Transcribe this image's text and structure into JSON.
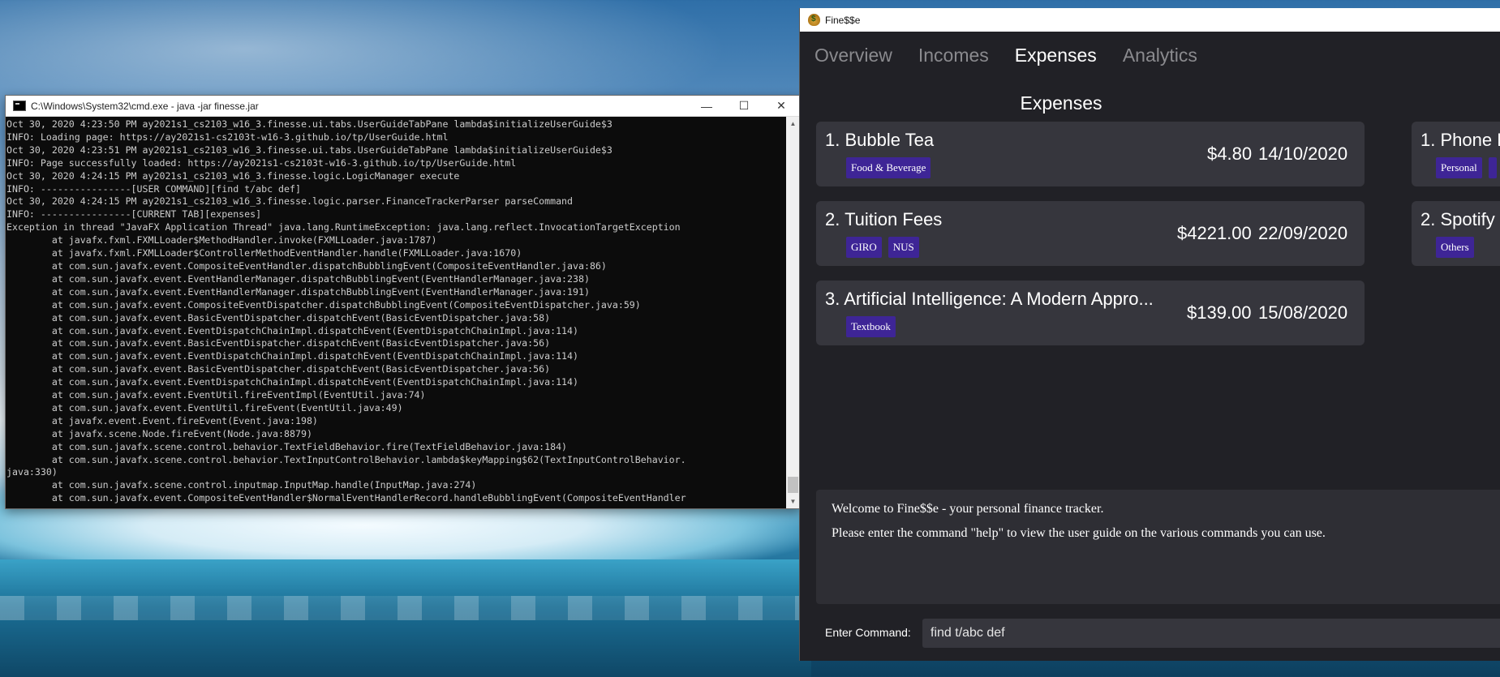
{
  "cmd_window": {
    "title": "C:\\Windows\\System32\\cmd.exe - java  -jar finesse.jar",
    "controls": {
      "minimize": "—",
      "maximize": "☐",
      "close": "✕"
    },
    "lines": [
      "Oct 30, 2020 4:23:50 PM ay2021s1_cs2103_w16_3.finesse.ui.tabs.UserGuideTabPane lambda$initializeUserGuide$3",
      "INFO: Loading page: https://ay2021s1-cs2103t-w16-3.github.io/tp/UserGuide.html",
      "Oct 30, 2020 4:23:51 PM ay2021s1_cs2103_w16_3.finesse.ui.tabs.UserGuideTabPane lambda$initializeUserGuide$3",
      "INFO: Page successfully loaded: https://ay2021s1-cs2103t-w16-3.github.io/tp/UserGuide.html",
      "Oct 30, 2020 4:24:15 PM ay2021s1_cs2103_w16_3.finesse.logic.LogicManager execute",
      "INFO: ----------------[USER COMMAND][find t/abc def]",
      "Oct 30, 2020 4:24:15 PM ay2021s1_cs2103_w16_3.finesse.logic.parser.FinanceTrackerParser parseCommand",
      "INFO: ----------------[CURRENT TAB][expenses]",
      "Exception in thread \"JavaFX Application Thread\" java.lang.RuntimeException: java.lang.reflect.InvocationTargetException",
      "        at javafx.fxml.FXMLLoader$MethodHandler.invoke(FXMLLoader.java:1787)",
      "        at javafx.fxml.FXMLLoader$ControllerMethodEventHandler.handle(FXMLLoader.java:1670)",
      "        at com.sun.javafx.event.CompositeEventHandler.dispatchBubblingEvent(CompositeEventHandler.java:86)",
      "        at com.sun.javafx.event.EventHandlerManager.dispatchBubblingEvent(EventHandlerManager.java:238)",
      "        at com.sun.javafx.event.EventHandlerManager.dispatchBubblingEvent(EventHandlerManager.java:191)",
      "        at com.sun.javafx.event.CompositeEventDispatcher.dispatchBubblingEvent(CompositeEventDispatcher.java:59)",
      "        at com.sun.javafx.event.BasicEventDispatcher.dispatchEvent(BasicEventDispatcher.java:58)",
      "        at com.sun.javafx.event.EventDispatchChainImpl.dispatchEvent(EventDispatchChainImpl.java:114)",
      "        at com.sun.javafx.event.BasicEventDispatcher.dispatchEvent(BasicEventDispatcher.java:56)",
      "        at com.sun.javafx.event.EventDispatchChainImpl.dispatchEvent(EventDispatchChainImpl.java:114)",
      "        at com.sun.javafx.event.BasicEventDispatcher.dispatchEvent(BasicEventDispatcher.java:56)",
      "        at com.sun.javafx.event.EventDispatchChainImpl.dispatchEvent(EventDispatchChainImpl.java:114)",
      "        at com.sun.javafx.event.EventUtil.fireEventImpl(EventUtil.java:74)",
      "        at com.sun.javafx.event.EventUtil.fireEvent(EventUtil.java:49)",
      "        at javafx.event.Event.fireEvent(Event.java:198)",
      "        at javafx.scene.Node.fireEvent(Node.java:8879)",
      "        at com.sun.javafx.scene.control.behavior.TextFieldBehavior.fire(TextFieldBehavior.java:184)",
      "        at com.sun.javafx.scene.control.behavior.TextInputControlBehavior.lambda$keyMapping$62(TextInputControlBehavior.",
      "java:330)",
      "        at com.sun.javafx.scene.control.inputmap.InputMap.handle(InputMap.java:274)",
      "        at com.sun.javafx.event.CompositeEventHandler$NormalEventHandlerRecord.handleBubblingEvent(CompositeEventHandler"
    ]
  },
  "finesse": {
    "title": "Fine$$e",
    "tabs": [
      "Overview",
      "Incomes",
      "Expenses",
      "Analytics"
    ],
    "active_tab": "Expenses",
    "section_title": "Expenses",
    "expenses": [
      {
        "name": "1. Bubble Tea",
        "amount": "$4.80",
        "date": "14/10/2020",
        "tags": [
          "Food & Beverage"
        ]
      },
      {
        "name": "2. Tuition Fees",
        "amount": "$4221.00",
        "date": "22/09/2020",
        "tags": [
          "GIRO",
          "NUS"
        ]
      },
      {
        "name": "3. Artificial Intelligence: A Modern Appro...",
        "amount": "$139.00",
        "date": "15/08/2020",
        "tags": [
          "Textbook"
        ]
      }
    ],
    "side_list": [
      {
        "name": "1. Phone B",
        "tags": [
          "Personal"
        ]
      },
      {
        "name": "2. Spotify S",
        "tags": [
          "Others"
        ]
      }
    ],
    "result_lines": [
      "Welcome to Fine$$e - your personal finance tracker.",
      "Please enter the command \"help\" to view the user guide on the various commands you can use."
    ],
    "command_label": "Enter Command:",
    "command_value": "find t/abc def"
  },
  "colors": {
    "app_bg": "#212126",
    "card_bg": "#36363d",
    "tag_bg": "#3e2596",
    "console_bg": "#0c0c0c"
  }
}
